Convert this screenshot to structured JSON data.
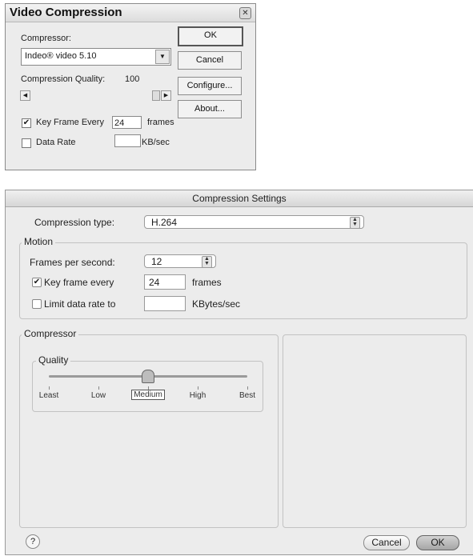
{
  "windows_dialog": {
    "title": "Video Compression",
    "close_glyph": "✕",
    "compressor_label": "Compressor:",
    "compressor_value": "Indeo® video 5.10",
    "quality_label": "Compression Quality:",
    "quality_value": "100",
    "keyframe_label": "Key Frame Every",
    "keyframe_value": "24",
    "keyframe_unit": "frames",
    "datarate_label": "Data Rate",
    "datarate_value": "",
    "datarate_unit": "KB/sec",
    "buttons": {
      "ok": "OK",
      "cancel": "Cancel",
      "configure": "Configure...",
      "about": "About..."
    },
    "keyframe_checked": true,
    "datarate_checked": false,
    "quality_fraction": 1.0
  },
  "mac_dialog": {
    "title": "Compression Settings",
    "compression_type_label": "Compression type:",
    "compression_type_value": "H.264",
    "motion_group": "Motion",
    "fps_label": "Frames per second:",
    "fps_value": "12",
    "keyframe_label": "Key frame every",
    "keyframe_value": "24",
    "keyframe_unit": "frames",
    "limit_label": "Limit data rate to",
    "limit_value": "",
    "limit_unit": "KBytes/sec",
    "compressor_group": "Compressor",
    "quality_group": "Quality",
    "quality_ticks": [
      "Least",
      "Low",
      "Medium",
      "High",
      "Best"
    ],
    "quality_selected": "Medium",
    "keyframe_checked": true,
    "limit_checked": false,
    "help_glyph": "?",
    "buttons": {
      "cancel": "Cancel",
      "ok": "OK"
    }
  }
}
